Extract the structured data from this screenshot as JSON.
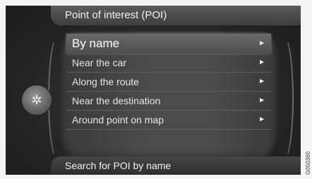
{
  "header": {
    "title": "Point of interest (POI)"
  },
  "menu": {
    "items": [
      {
        "label": "By name",
        "arrow": "►"
      },
      {
        "label": "Near the car",
        "arrow": "►"
      },
      {
        "label": "Along the route",
        "arrow": "►"
      },
      {
        "label": "Near the destination",
        "arrow": "►"
      },
      {
        "label": "Around point on map",
        "arrow": "►"
      }
    ]
  },
  "footer": {
    "text": "Search for POI by name"
  },
  "knob": {
    "icon": "compass-icon",
    "glyph": "✲"
  },
  "watermark": "G050360"
}
